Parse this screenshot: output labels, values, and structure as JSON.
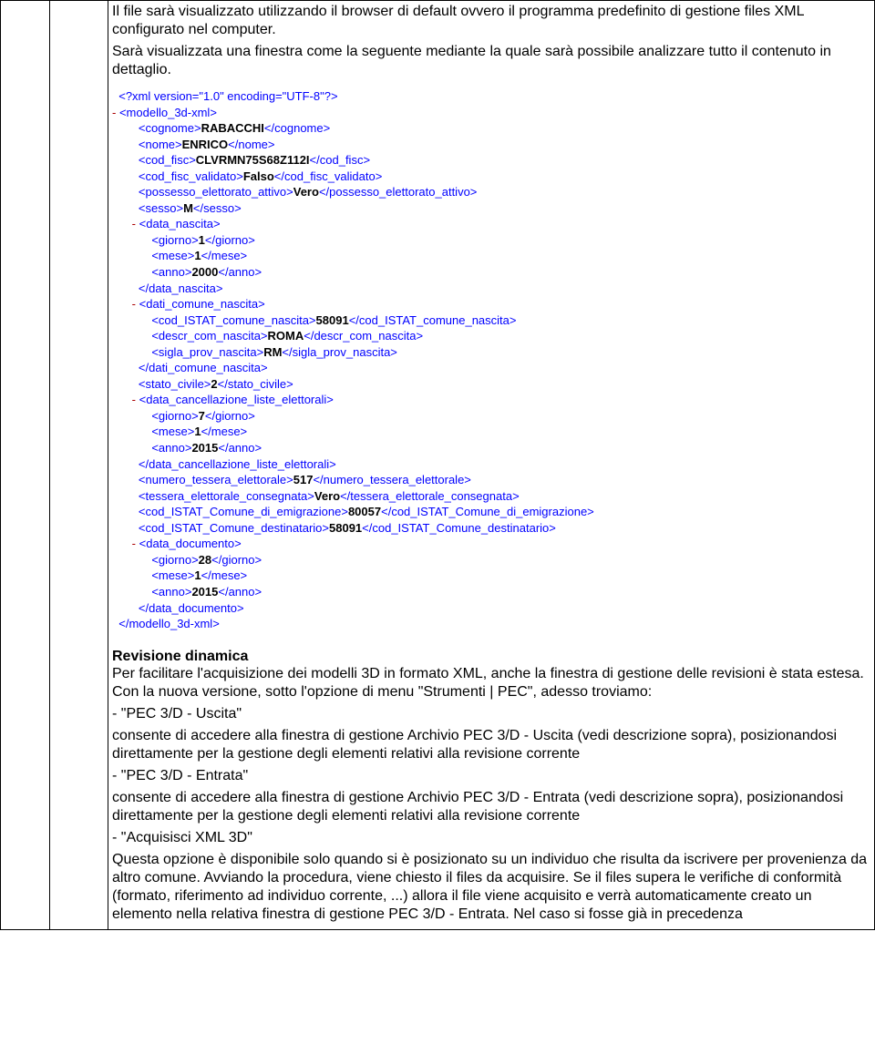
{
  "intro": {
    "p1": "Il file sarà visualizzato utilizzando il browser di default ovvero il programma predefinito di gestione files XML configurato nel computer.",
    "p2": "Sarà visualizzata una finestra come la seguente mediante la quale sarà possibile analizzare tutto il contenuto in dettaglio."
  },
  "xml": {
    "decl": "<?xml version=\"1.0\" encoding=\"UTF-8\"?>",
    "root_open": "<modello_3d-xml>",
    "root_close": "</modello_3d-xml>",
    "lines": [
      {
        "indent": 3,
        "tag": "cognome",
        "val": "RABACCHI"
      },
      {
        "indent": 3,
        "tag": "nome",
        "val": "ENRICO"
      },
      {
        "indent": 3,
        "tag": "cod_fisc",
        "val": "CLVRMN75S68Z112I"
      },
      {
        "indent": 3,
        "tag": "cod_fisc_validato",
        "val": "Falso"
      },
      {
        "indent": 3,
        "tag": "possesso_elettorato_attivo",
        "val": "Vero"
      },
      {
        "indent": 3,
        "tag": "sesso",
        "val": "M"
      }
    ],
    "data_nascita": {
      "open": "<data_nascita>",
      "close": "</data_nascita>",
      "giorno": "1",
      "mese": "1",
      "anno": "2000"
    },
    "dati_comune_nascita": {
      "open": "<dati_comune_nascita>",
      "close": "</dati_comune_nascita>",
      "cod_ISTAT_comune_nascita": "58091",
      "descr_com_nascita": "ROMA",
      "sigla_prov_nascita": "RM"
    },
    "stato_civile": {
      "tag": "stato_civile",
      "val": "2"
    },
    "data_canc": {
      "open": "<data_cancellazione_liste_elettorali>",
      "close": "</data_cancellazione_liste_elettorali>",
      "giorno": "7",
      "mese": "1",
      "anno": "2015"
    },
    "numero_tessera": {
      "tag": "numero_tessera_elettorale",
      "val": "517"
    },
    "tessera_consegnata": {
      "tag": "tessera_elettorale_consegnata",
      "val": "Vero"
    },
    "cod_emigr": {
      "tag": "cod_ISTAT_Comune_di_emigrazione",
      "val": "80057"
    },
    "cod_dest": {
      "tag": "cod_ISTAT_Comune_destinatario",
      "val": "58091"
    },
    "data_doc": {
      "open": "<data_documento>",
      "close": "</data_documento>",
      "giorno": "28",
      "mese": "1",
      "anno": "2015"
    }
  },
  "revision": {
    "title": "Revisione dinamica",
    "body": "Per facilitare l'acquisizione dei modelli 3D in formato XML, anche la finestra di gestione delle revisioni è stata estesa. Con la nuova versione, sotto l'opzione di menu \"Strumenti | PEC\", adesso troviamo:",
    "item1_title": "- \"PEC 3/D - Uscita\"",
    "item1_body": "consente di accedere alla finestra di gestione Archivio PEC 3/D - Uscita (vedi descrizione sopra), posizionandosi direttamente per la gestione degli elementi relativi alla revisione corrente",
    "item2_title": "- \"PEC 3/D - Entrata\"",
    "item2_body": "consente di accedere alla finestra di gestione Archivio PEC 3/D - Entrata (vedi descrizione sopra), posizionandosi direttamente per la gestione degli elementi relativi alla revisione corrente",
    "item3_title": "- \"Acquisisci XML 3D\"",
    "item3_body": "Questa opzione è disponibile solo quando si è posizionato su un individuo che risulta da iscrivere per provenienza da altro comune. Avviando la procedura, viene chiesto il files da acquisire. Se il files supera le verifiche di conformità (formato, riferimento ad individuo corrente, ...) allora il file viene acquisito e verrà automaticamente creato un elemento nella relativa finestra di gestione PEC 3/D - Entrata. Nel caso si fosse già in precedenza"
  }
}
